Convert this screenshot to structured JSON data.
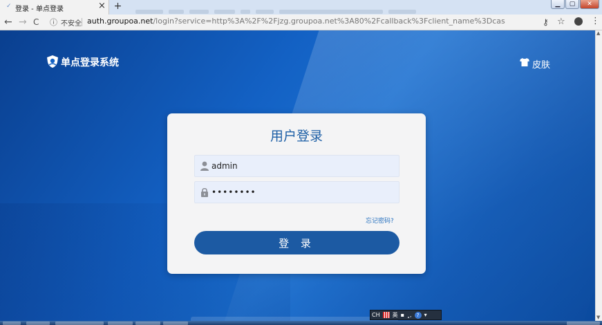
{
  "browser": {
    "tab": {
      "title": "登录 - 单点登录",
      "close": "×"
    },
    "new_tab": "+",
    "window_buttons": {
      "minimize": "▁",
      "maximize": "▢",
      "close": "✕"
    },
    "nav": {
      "back": "←",
      "forward": "→",
      "reload": "C"
    },
    "security_label": "不安全",
    "url_host": "auth.groupoa.net",
    "url_path": "/login?service=http%3A%2F%2Fjzg.groupoa.net%3A80%2Fcallback%3Fclient_name%3Dcas",
    "toolbar_icons": {
      "key": "⚷",
      "star": "☆",
      "menu": "⋮"
    }
  },
  "header": {
    "brand": "单点登录系统",
    "skin_label": "皮肤"
  },
  "login": {
    "title": "用户登录",
    "username": "admin",
    "password_masked": "••••••••",
    "forgot": "忘记密码?",
    "submit": "登 录"
  },
  "ime": {
    "lang": "CH",
    "mode": "英"
  },
  "colors": {
    "page_bg": "#1361c4",
    "card_bg": "#f4f4f5",
    "title": "#1d5fa6",
    "button": "#1c5aa3",
    "link": "#2a73c0"
  }
}
